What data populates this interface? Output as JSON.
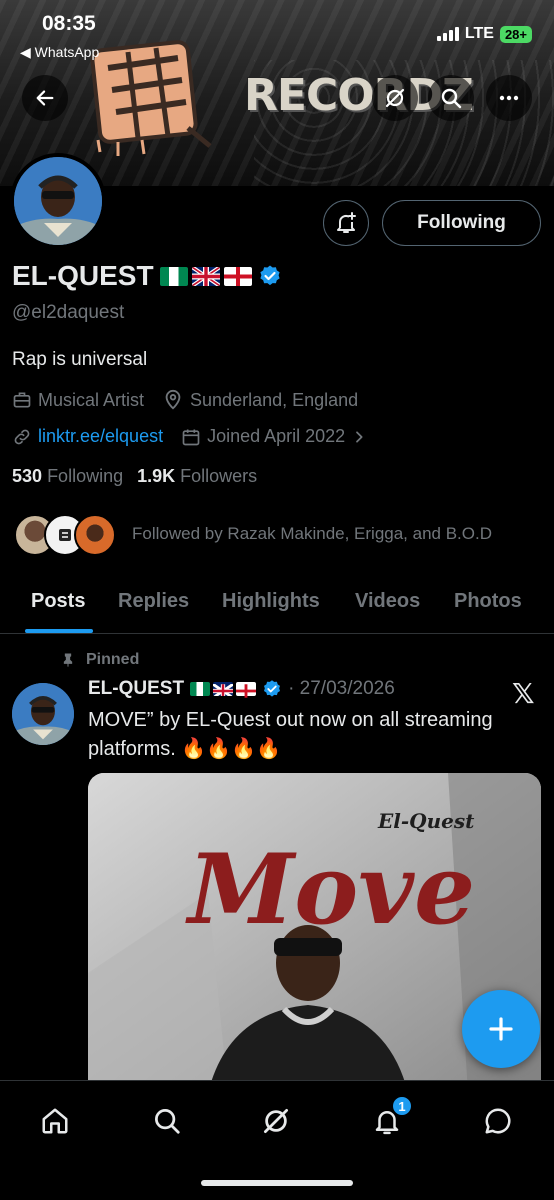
{
  "status_bar": {
    "time": "08:35",
    "back_app": "◀ WhatsApp",
    "network": "LTE",
    "battery": "28+"
  },
  "banner": {
    "logo_text": "RECORDZ"
  },
  "profile": {
    "name": "EL-QUEST",
    "flags": [
      "Nigeria",
      "United Kingdom",
      "England"
    ],
    "handle": "@el2daquest",
    "bio": "Rap is universal",
    "category": "Musical Artist",
    "location": "Sunderland, England",
    "link": "linktr.ee/elquest",
    "joined": "Joined April 2022",
    "following_count": "530",
    "following_label": "Following",
    "followers_count": "1.9K",
    "followers_label": "Followers",
    "followed_by": "Followed by Razak Makinde, Erigga, and B.O.D",
    "follow_button": "Following"
  },
  "tabs": [
    {
      "label": "Posts",
      "active": true
    },
    {
      "label": "Replies",
      "active": false
    },
    {
      "label": "Highlights",
      "active": false
    },
    {
      "label": "Videos",
      "active": false
    },
    {
      "label": "Photos",
      "active": false
    }
  ],
  "pinned_post": {
    "pinned_label": "Pinned",
    "author": "EL-QUEST",
    "date": "27/03/2026",
    "text": "MOVE” by EL-Quest out now on all streaming platforms. 🔥🔥🔥🔥",
    "media_title": "Move",
    "media_artist": "El-Quest"
  },
  "bottom_nav": {
    "items": [
      "home-icon",
      "search-icon",
      "grok-icon",
      "notifications-icon",
      "messages-icon"
    ],
    "notification_badge": "1"
  },
  "colors": {
    "accent": "#1d9bf0",
    "background": "#000000",
    "muted_text": "#71767b",
    "battery_green": "#4cd964"
  }
}
